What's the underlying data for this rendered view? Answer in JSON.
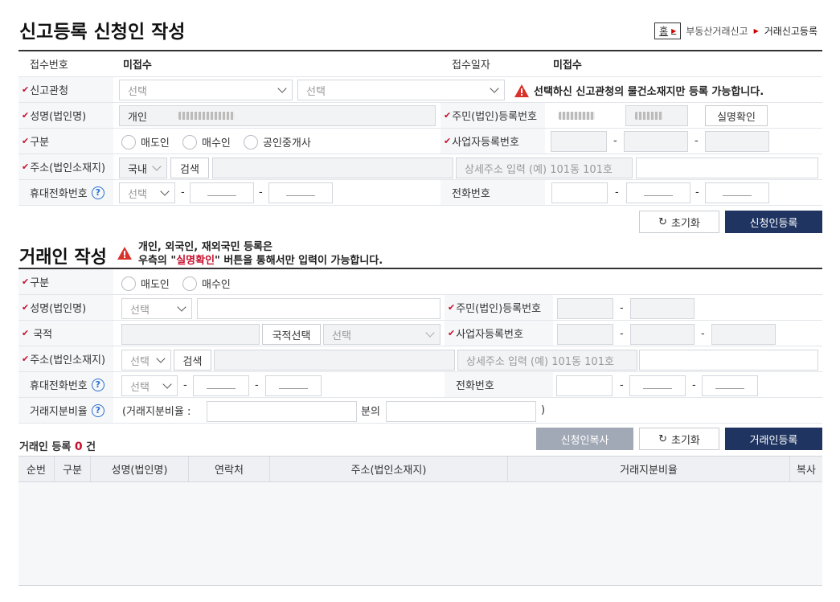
{
  "header": {
    "title": "신고등록 신청인 작성",
    "breadcrumb": {
      "home": "홈",
      "section": "부동산거래신고",
      "current": "거래신고등록"
    }
  },
  "applicant": {
    "receipt_no_label": "접수번호",
    "receipt_no_value": "미접수",
    "receipt_date_label": "접수일자",
    "receipt_date_value": "미접수",
    "office_label": "신고관청",
    "office_select1": "선택",
    "office_select2": "선택",
    "office_warning": "선택하신 신고관청의 물건소재지만 등록 가능합니다.",
    "name_label": "성명(법인명)",
    "name_prefix": "개인",
    "rrn_label": "주민(법인)등록번호",
    "verify_button": "실명확인",
    "type_label": "구분",
    "type_options": [
      "매도인",
      "매수인",
      "공인중개사"
    ],
    "bizno_label": "사업자등록번호",
    "address_label": "주소(법인소재지)",
    "address_country": "국내",
    "address_search": "검색",
    "address_detail_placeholder": "상세주소 입력 (예) 101동 101호",
    "mobile_label": "휴대전화번호",
    "mobile_select": "선택",
    "phone_label": "전화번호",
    "reset_button": "초기화",
    "register_button": "신청인등록"
  },
  "trader": {
    "title": "거래인 작성",
    "notice_line1": "개인, 외국인, 재외국민 등록은",
    "notice_line2_pre": "우측의 \"",
    "notice_line2_red": "실명확인",
    "notice_line2_post": "\" 버튼을 통해서만 입력이 가능합니다.",
    "type_label": "구분",
    "type_options": [
      "매도인",
      "매수인"
    ],
    "name_label": "성명(법인명)",
    "name_select": "선택",
    "rrn_label": "주민(법인)등록번호",
    "nationality_label": "국적",
    "nationality_button": "국적선택",
    "nationality_select": "선택",
    "bizno_label": "사업자등록번호",
    "address_label": "주소(법인소재지)",
    "address_select": "선택",
    "address_search": "검색",
    "address_detail_placeholder": "상세주소 입력 (예) 101동 101호",
    "mobile_label": "휴대전화번호",
    "mobile_select": "선택",
    "phone_label": "전화번호",
    "ratio_label": "거래지분비율",
    "ratio_prefix": "(거래지분비율 :",
    "ratio_mid": "분의",
    "ratio_suffix": ")",
    "copy_button": "신청인복사",
    "reset_button": "초기화",
    "register_button": "거래인등록"
  },
  "list": {
    "count_prefix": "거래인 등록",
    "count_value": "0",
    "count_suffix": "건",
    "columns": [
      "순번",
      "구분",
      "성명(법인명)",
      "연락처",
      "주소(법인소재지)",
      "거래지분비율",
      "복사"
    ]
  },
  "colors": {
    "navy": "#1f3461",
    "required": "#c8102e",
    "help": "#2a6fd0"
  }
}
